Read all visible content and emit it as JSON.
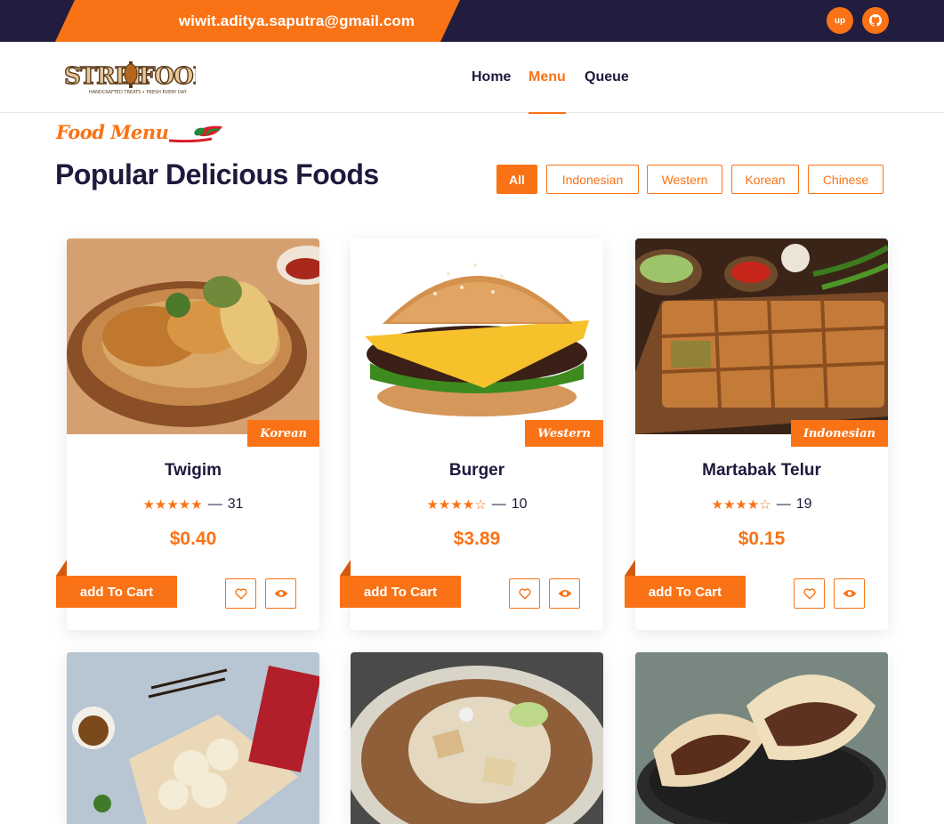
{
  "topbar": {
    "email": "wiwit.aditya.saputra@gmail.com",
    "social": [
      {
        "icon": "upwork-icon",
        "label": "up"
      },
      {
        "icon": "github-icon",
        "label": ""
      }
    ]
  },
  "nav": {
    "logo_text": "STREE FOOD",
    "logo_tagline": "HANDCRAFTED TREATS • FRESH EVERY DAY",
    "items": [
      {
        "label": "Home",
        "active": false
      },
      {
        "label": "Menu",
        "active": true
      },
      {
        "label": "Queue",
        "active": false
      }
    ]
  },
  "section": {
    "eyebrow": "Food Menu",
    "title": "Popular Delicious Foods",
    "filters": [
      "All",
      "Indonesian",
      "Western",
      "Korean",
      "Chinese"
    ],
    "active_filter": "All"
  },
  "cards": [
    {
      "name": "Twigim",
      "category": "Korean",
      "rating": 5,
      "stars": "★★★★★",
      "reviews": "31",
      "price": "$0.40",
      "cart_label": "add To Cart"
    },
    {
      "name": "Burger",
      "category": "Western",
      "rating": 4.5,
      "stars": "★★★★☆",
      "reviews": "10",
      "price": "$3.89",
      "cart_label": "add To Cart"
    },
    {
      "name": "Martabak Telur",
      "category": "Indonesian",
      "rating": 4.5,
      "stars": "★★★★☆",
      "reviews": "19",
      "price": "$0.15",
      "cart_label": "add To Cart"
    },
    {
      "name": "",
      "category": "",
      "stars": "",
      "reviews": "",
      "price": "",
      "cart_label": ""
    },
    {
      "name": "",
      "category": "",
      "stars": "",
      "reviews": "",
      "price": "",
      "cart_label": ""
    },
    {
      "name": "",
      "category": "",
      "stars": "",
      "reviews": "",
      "price": "",
      "cart_label": ""
    }
  ],
  "separator": "—",
  "colors": {
    "accent": "#f97316",
    "dark": "#221d3e",
    "text": "#1d1a3d"
  }
}
